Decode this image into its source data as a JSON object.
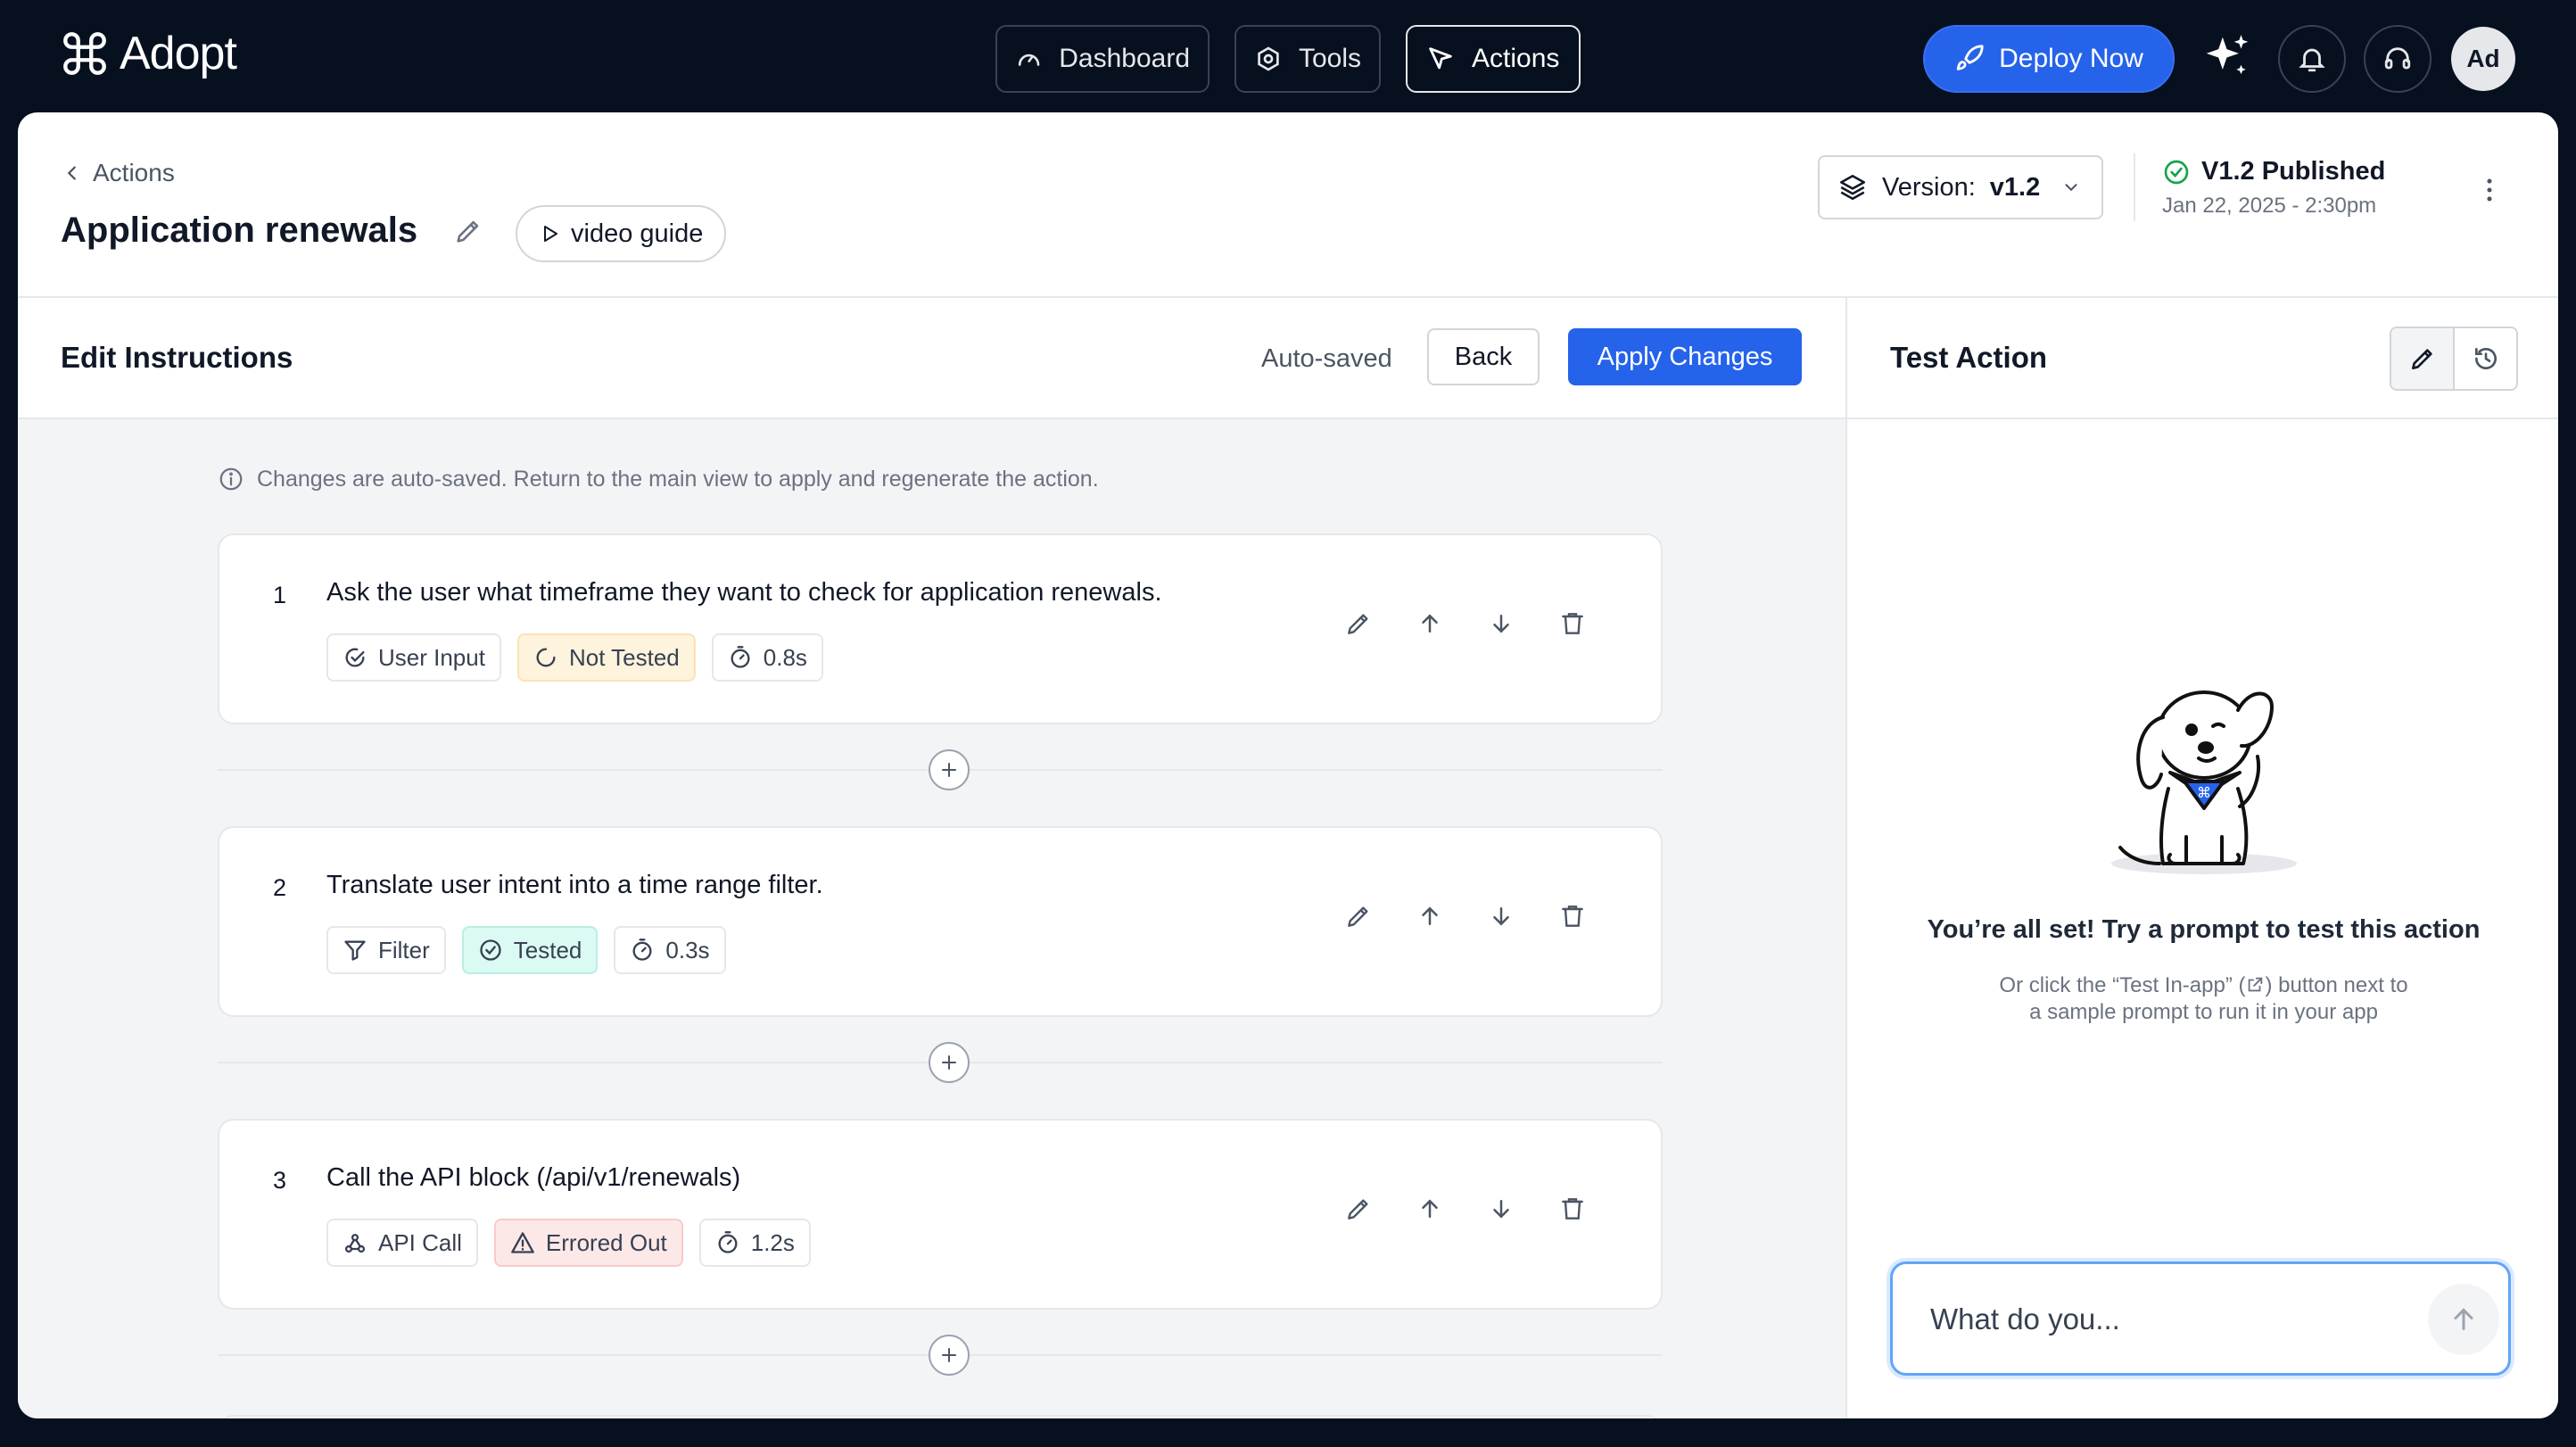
{
  "app": {
    "brand": "Adopt"
  },
  "nav": {
    "tabs": [
      {
        "label": "Dashboard",
        "icon": "gauge-icon"
      },
      {
        "label": "Tools",
        "icon": "gear-icon"
      },
      {
        "label": "Actions",
        "icon": "cursor-icon",
        "active": true
      }
    ],
    "deploy_label": "Deploy Now",
    "avatar_initials": "Ad"
  },
  "header": {
    "breadcrumb": "Actions",
    "title": "Application renewals",
    "video_label": "video guide",
    "version_label": "Version:",
    "version_value": "v1.2",
    "published_label": "V1.2 Published",
    "published_date": "Jan 22, 2025 - 2:30pm"
  },
  "editor": {
    "title": "Edit Instructions",
    "autosaved": "Auto-saved",
    "back_label": "Back",
    "apply_label": "Apply Changes",
    "info": "Changes are auto-saved. Return to the main view to apply and regenerate the action.",
    "steps": [
      {
        "num": "1",
        "text": "Ask the user what timeframe they want to check for application renewals.",
        "type": "User Input",
        "status": "Not Tested",
        "time": "0.8s"
      },
      {
        "num": "2",
        "text": "Translate user intent into a time range filter.",
        "type": "Filter",
        "status": "Tested",
        "time": "0.3s"
      },
      {
        "num": "3",
        "text": "Call the API block (/api/v1/renewals)",
        "type": "API Call",
        "status": "Errored Out",
        "time": "1.2s"
      }
    ]
  },
  "test": {
    "title": "Test Action",
    "empty_title": "You’re all set! Try a prompt to test this action",
    "empty_sub_1": "Or click the “Test In-app” (",
    "empty_sub_2": ") button next to",
    "empty_sub_3": "a sample prompt to run it in your app",
    "prompt_placeholder": "What do you..."
  },
  "colors": {
    "accent": "#2563eb",
    "nav_bg": "#07101f",
    "warn_bg": "#fef3dc",
    "ok_bg": "#dcfaf4",
    "err_bg": "#fde8e8"
  }
}
